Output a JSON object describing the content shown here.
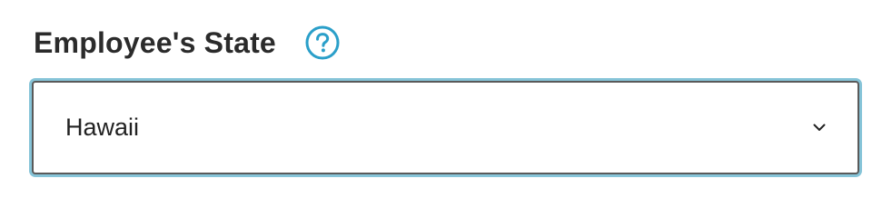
{
  "field": {
    "label": "Employee's State",
    "selected_value": "Hawaii"
  },
  "icons": {
    "help": "question-circle-icon",
    "dropdown": "chevron-down-icon"
  },
  "colors": {
    "label_text": "#2b2b2b",
    "help_icon": "#2a9fc9",
    "focus_ring": "#86c4d8",
    "select_border": "#5a5a5a",
    "value_text": "#222222"
  }
}
